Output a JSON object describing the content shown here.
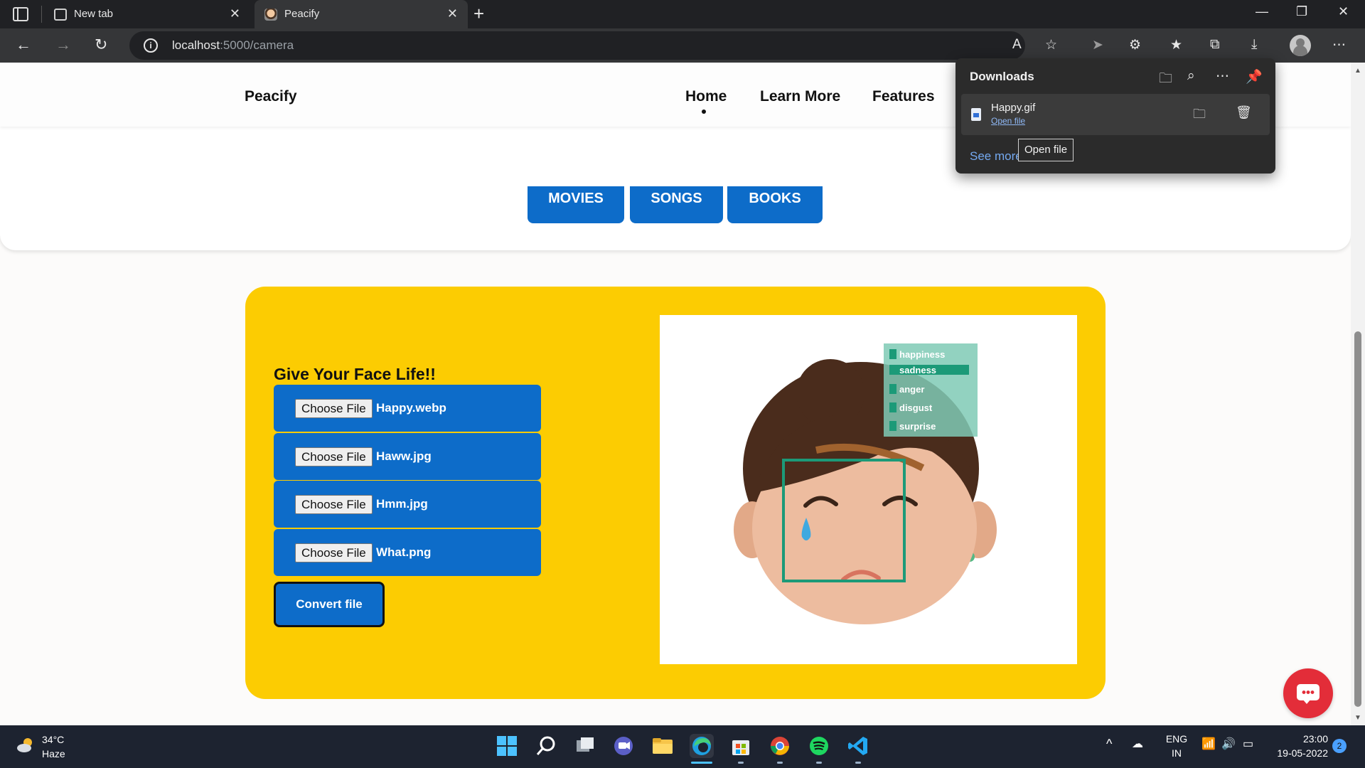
{
  "browser": {
    "tabs": [
      {
        "label": "New tab"
      },
      {
        "label": "Peacify"
      }
    ],
    "new_tab_symbol": "+",
    "url_host": "localhost",
    "url_path": ":5000/camera"
  },
  "site": {
    "brand": "Peacify",
    "nav": [
      "Home",
      "Learn More",
      "Features"
    ],
    "categories": [
      "MOVIES",
      "SONGS",
      "BOOKS"
    ]
  },
  "panel": {
    "title": "Give Your Face Life!!",
    "files": [
      {
        "button": "Choose File",
        "name": "Happy.webp"
      },
      {
        "button": "Choose File",
        "name": "Haww.jpg"
      },
      {
        "button": "Choose File",
        "name": "Hmm.jpg"
      },
      {
        "button": "Choose File",
        "name": "What.png"
      }
    ],
    "convert_label": "Convert file",
    "emotions": [
      "happiness",
      "sadness",
      "anger",
      "disgust",
      "surprise"
    ],
    "selected_emotion": "sadness"
  },
  "downloads": {
    "title": "Downloads",
    "item_name": "Happy.gif",
    "item_action": "Open file",
    "see_more": "See more",
    "tooltip": "Open file"
  },
  "taskbar": {
    "temperature": "34°C",
    "weather": "Haze",
    "language_1": "ENG",
    "language_2": "IN",
    "time": "23:00",
    "date": "19-05-2022",
    "notifications": "2"
  },
  "colors": {
    "accent_blue": "#0d6cc9",
    "panel_yellow": "#fccc02",
    "chat_red": "#e32d39"
  }
}
